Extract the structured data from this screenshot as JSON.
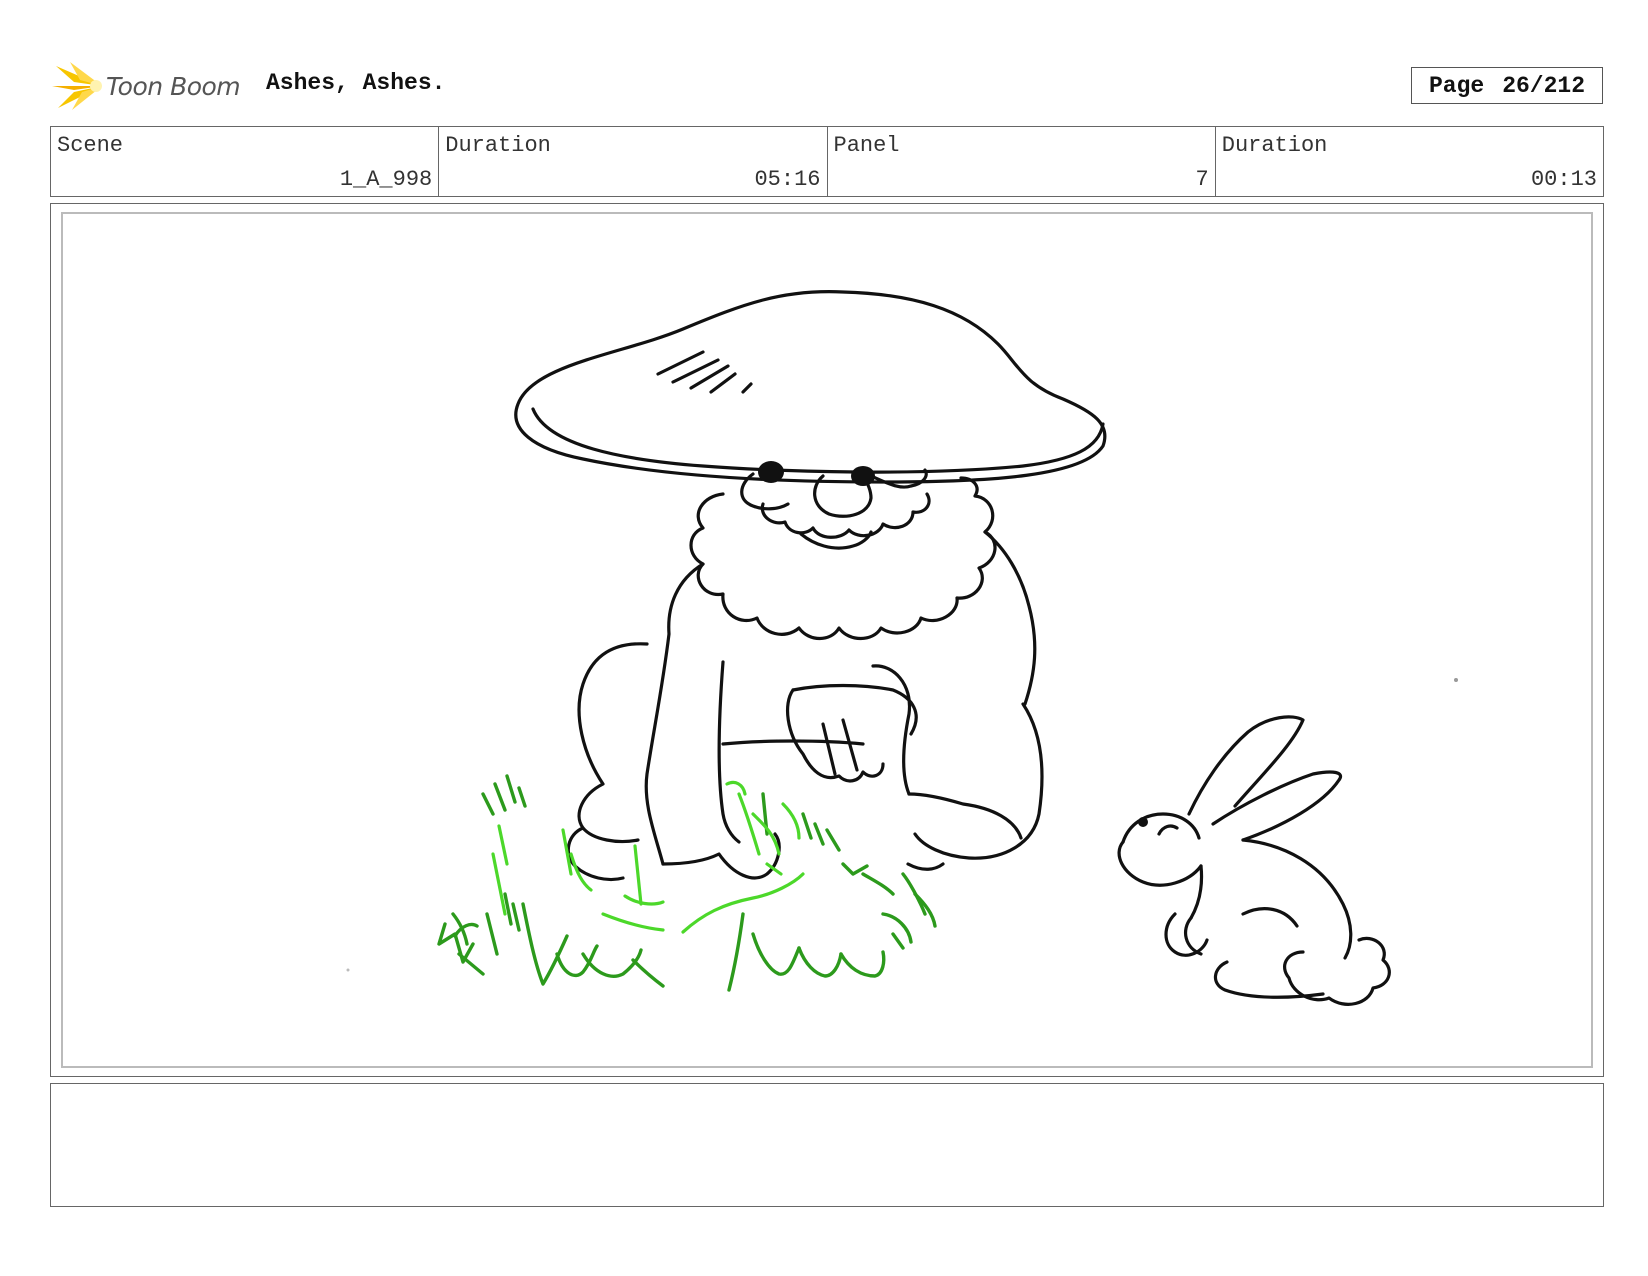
{
  "header": {
    "logo_text": "Toon Boom",
    "title": "Ashes, Ashes.",
    "page_label": "Page",
    "page_value": "26/212"
  },
  "info": {
    "scene_label": "Scene",
    "scene_value": "1_A_998",
    "scene_duration_label": "Duration",
    "scene_duration_value": "05:16",
    "panel_label": "Panel",
    "panel_value": "7",
    "panel_duration_label": "Duration",
    "panel_duration_value": "00:13"
  },
  "notes": {
    "text": ""
  },
  "colors": {
    "logo_yellow": "#f5b800",
    "line": "#111111",
    "grass_dark": "#2c9a1c",
    "grass_light": "#4cd82a"
  }
}
